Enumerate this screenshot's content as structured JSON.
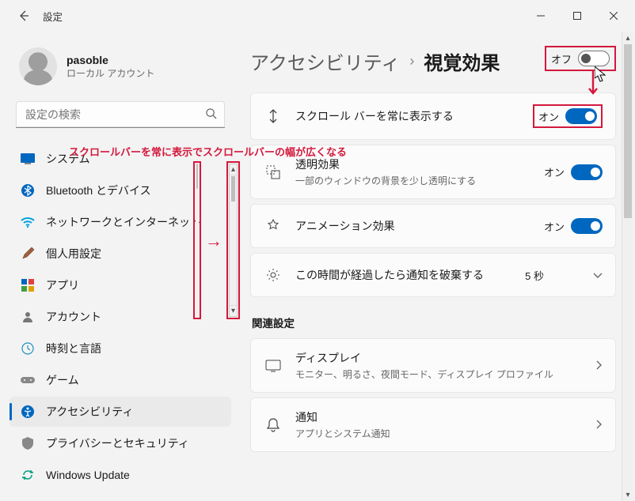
{
  "window": {
    "title": "設定",
    "profile": {
      "name": "pasoble",
      "sub": "ローカル アカウント"
    },
    "search_placeholder": "設定の検索"
  },
  "nav": {
    "items": [
      {
        "label": "システム"
      },
      {
        "label": "Bluetooth とデバイス"
      },
      {
        "label": "ネットワークとインターネット"
      },
      {
        "label": "個人用設定"
      },
      {
        "label": "アプリ"
      },
      {
        "label": "アカウント"
      },
      {
        "label": "時刻と言語"
      },
      {
        "label": "ゲーム"
      },
      {
        "label": "アクセシビリティ"
      },
      {
        "label": "プライバシーとセキュリティ"
      },
      {
        "label": "Windows Update"
      }
    ]
  },
  "breadcrumb": {
    "parent": "アクセシビリティ",
    "sep": "›",
    "current": "視覚効果"
  },
  "off_overlay": {
    "label": "オフ"
  },
  "annotation": "スクロールバーを常に表示でスクロールバーの幅が広くなる",
  "settings": {
    "scrollbars": {
      "title": "スクロール バーを常に表示する",
      "state": "オン"
    },
    "transparency": {
      "title": "透明効果",
      "sub": "一部のウィンドウの背景を少し透明にする",
      "state": "オン"
    },
    "animation": {
      "title": "アニメーション効果",
      "state": "オン"
    },
    "notification_timeout": {
      "title": "この時間が経過したら通知を破棄する",
      "value": "5 秒"
    }
  },
  "related": {
    "heading": "関連設定",
    "display": {
      "title": "ディスプレイ",
      "sub": "モニター、明るさ、夜間モード、ディスプレイ プロファイル"
    },
    "notifications": {
      "title": "通知",
      "sub": "アプリとシステム通知"
    }
  }
}
